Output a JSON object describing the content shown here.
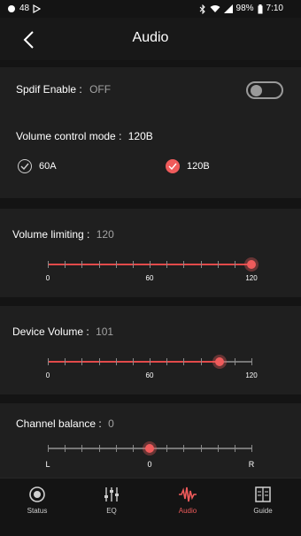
{
  "status_bar": {
    "notif_count": "48",
    "battery": "98%",
    "time": "7:10"
  },
  "header": {
    "title": "Audio"
  },
  "spdif": {
    "label": "Spdif Enable :",
    "value": "OFF"
  },
  "volume_mode": {
    "label": "Volume control mode :",
    "value": "120B",
    "options": [
      {
        "label": "60A",
        "selected": false
      },
      {
        "label": "120B",
        "selected": true
      }
    ]
  },
  "volume_limiting": {
    "label": "Volume limiting :",
    "value": "120",
    "min": 0,
    "max": 120,
    "current": 120,
    "ticks": [
      "0",
      "60",
      "120"
    ]
  },
  "device_volume": {
    "label": "Device Volume :",
    "value": "101",
    "min": 0,
    "max": 120,
    "current": 101,
    "ticks": [
      "0",
      "60",
      "120"
    ]
  },
  "channel_balance": {
    "label": "Channel balance :",
    "value": "0",
    "min": -1,
    "max": 1,
    "current": 0,
    "ticks": [
      "L",
      "0",
      "R"
    ]
  },
  "bottom_nav": [
    {
      "label": "Status",
      "icon": "status-icon",
      "active": false
    },
    {
      "label": "EQ",
      "icon": "eq-icon",
      "active": false
    },
    {
      "label": "Audio",
      "icon": "audio-wave-icon",
      "active": true
    },
    {
      "label": "Guide",
      "icon": "guide-book-icon",
      "active": false
    }
  ],
  "colors": {
    "accent": "#ef5b5b",
    "background": "#141414",
    "card": "#1f1f1f"
  }
}
